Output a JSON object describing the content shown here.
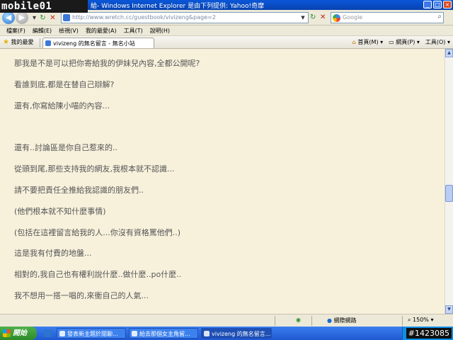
{
  "window": {
    "logo_text": "mobile01",
    "title": "- Windows Internet Explorer 是由下列提供: Yahoo!奇摩",
    "title_prefix": "給"
  },
  "toolbar": {
    "url": "http://www.wretch.cc/guestbook/vivizeng&page=2",
    "search_placeholder": "Google"
  },
  "menu": [
    "檔案(F)",
    "編輯(E)",
    "檢視(V)",
    "我的最愛(A)",
    "工具(T)",
    "說明(H)"
  ],
  "tabbar": {
    "favorites_label": "我的最愛",
    "tab_title": "vivizeng 的無名留言 - 無名小站",
    "home_label": "首頁(M)",
    "page_label": "網頁(P)",
    "tools_label": "工具(O)"
  },
  "content": {
    "lines": [
      "那我是不是可以把你寄給我的伊妹兒內容,全都公開呢?",
      "看誰到底,都是在替自己辯解?",
      "還有,你寫給陳小喵的內容...",
      "還有..討論區是你自己惹來的..",
      "從頭到尾,那些支持我的網友,我根本就不認識...",
      "請不要把責任全推給我認識的朋友們..",
      "(他們根本就不知什麼事情)",
      "(包括在這裡留言給我的人...你沒有資格罵他們..)",
      "這是我有付費的地盤...",
      "相對的,我自己也有權利說什麼..做什麼..po什麼..",
      "我不想用一搭一唱的,來衝自己的人氣..."
    ]
  },
  "statusbar": {
    "zone_label": "網際網路",
    "zoom": "150%"
  },
  "taskbar": {
    "start_label": "開始",
    "tasks": [
      "發表新主題於閒聊...",
      "給去那個女主角留...",
      "vivizeng 的無名留言..."
    ],
    "watermark": "#1423085"
  }
}
